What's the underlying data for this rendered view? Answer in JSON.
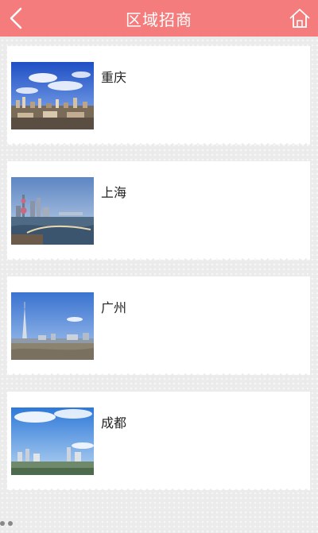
{
  "header": {
    "title": "区域招商",
    "back_icon": "chevron-left-icon",
    "home_icon": "home-icon",
    "color": "#f47c7c"
  },
  "cities": [
    {
      "name": "重庆"
    },
    {
      "name": "上海"
    },
    {
      "name": "广州"
    },
    {
      "name": "成都"
    }
  ]
}
